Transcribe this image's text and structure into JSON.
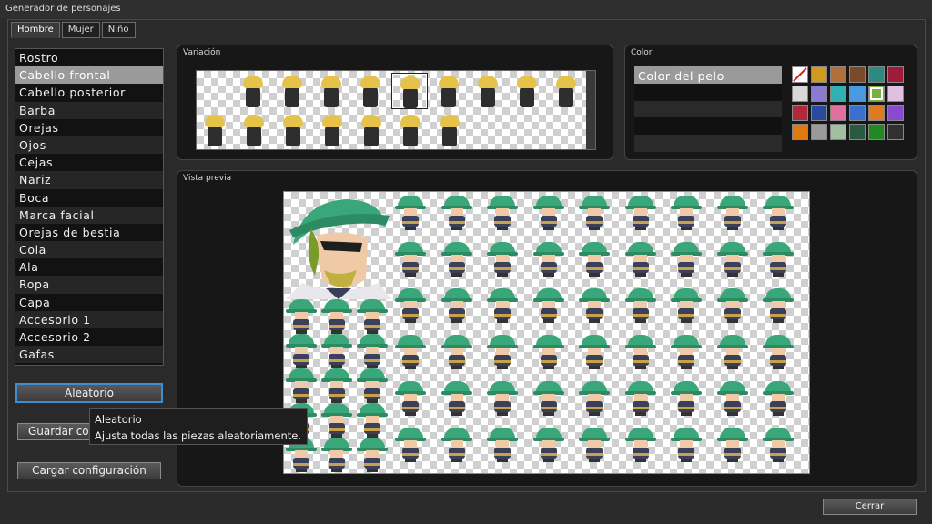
{
  "window": {
    "title": "Generador de personajes"
  },
  "tabs": [
    {
      "label": "Hombre",
      "active": true
    },
    {
      "label": "Mujer",
      "active": false
    },
    {
      "label": "Niño",
      "active": false
    }
  ],
  "parts": [
    "Rostro",
    "Cabello frontal",
    "Cabello posterior",
    "Barba",
    "Orejas",
    "Ojos",
    "Cejas",
    "Nariz",
    "Boca",
    "Marca facial",
    "Orejas de bestia",
    "Cola",
    "Ala",
    "Ropa",
    "Capa",
    "Accesorio 1",
    "Accesorio 2",
    "Gafas"
  ],
  "selected_part": "Cabello frontal",
  "buttons": {
    "random": "Aleatorio",
    "save": "Guardar configuración",
    "load": "Cargar configuración",
    "close": "Cerrar"
  },
  "panels": {
    "variation": "Variación",
    "color": "Color",
    "preview": "Vista previa"
  },
  "color_rows": [
    "Color del pelo",
    "",
    "",
    "",
    ""
  ],
  "tooltip": {
    "title": "Aleatorio",
    "text": "Ajusta todas las piezas aleatoriamente."
  },
  "colors": {
    "swatches": [
      "#ffffff",
      "#d09a20",
      "#b0703a",
      "#7a4a2a",
      "#2d8a80",
      "#a01a3a",
      "#d8d8d8",
      "#8a7ad0",
      "#30b0b0",
      "#4a9ae0",
      "#7ab040",
      "#e0c0e0",
      "#b02a3a",
      "#2a4aa0",
      "#e070a0",
      "#3a70d0",
      "#e07a20",
      "#8a4ad0",
      "#e07a10",
      "#9a9a9a",
      "#a0c0a0",
      "#2a5a40",
      "#208a20",
      "#303030"
    ],
    "hair": "#e5c24a",
    "hat": "#3aa77a",
    "focus": "#3d8dcf"
  }
}
